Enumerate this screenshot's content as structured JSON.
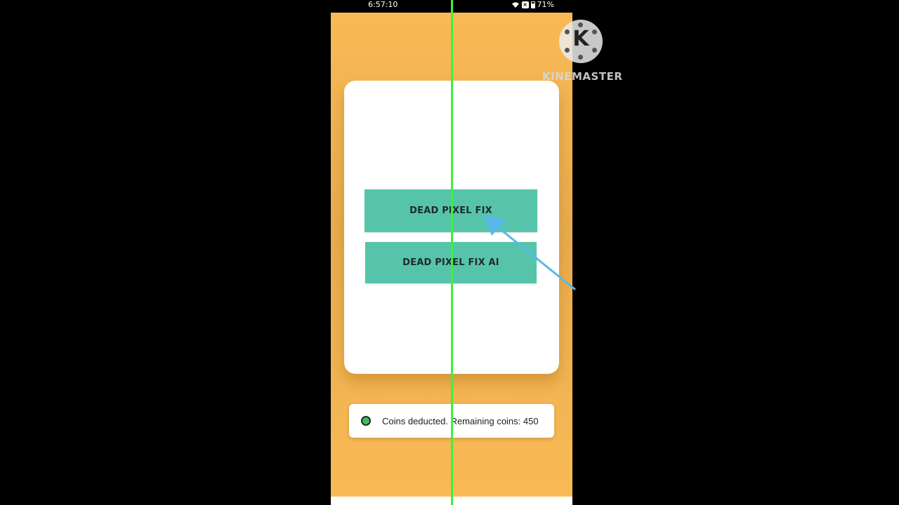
{
  "status_bar": {
    "time": "6:57:10",
    "battery_percent": "71%",
    "icons": [
      "wifi-icon",
      "signal-x-icon",
      "battery-icon"
    ]
  },
  "main": {
    "buttons": [
      {
        "label": "DEAD PIXEL FIX"
      },
      {
        "label": "DEAD PIXEL FIX AI"
      }
    ]
  },
  "toast": {
    "message": "Coins deducted. Remaining coins: 450"
  },
  "watermark": {
    "letter": "K",
    "text": "KINEMASTER"
  },
  "colors": {
    "background": "#f9ba55",
    "button": "#56c4ab",
    "card": "#ffffff",
    "guide_line": "#3df03d",
    "arrow": "#5ab8e8"
  }
}
